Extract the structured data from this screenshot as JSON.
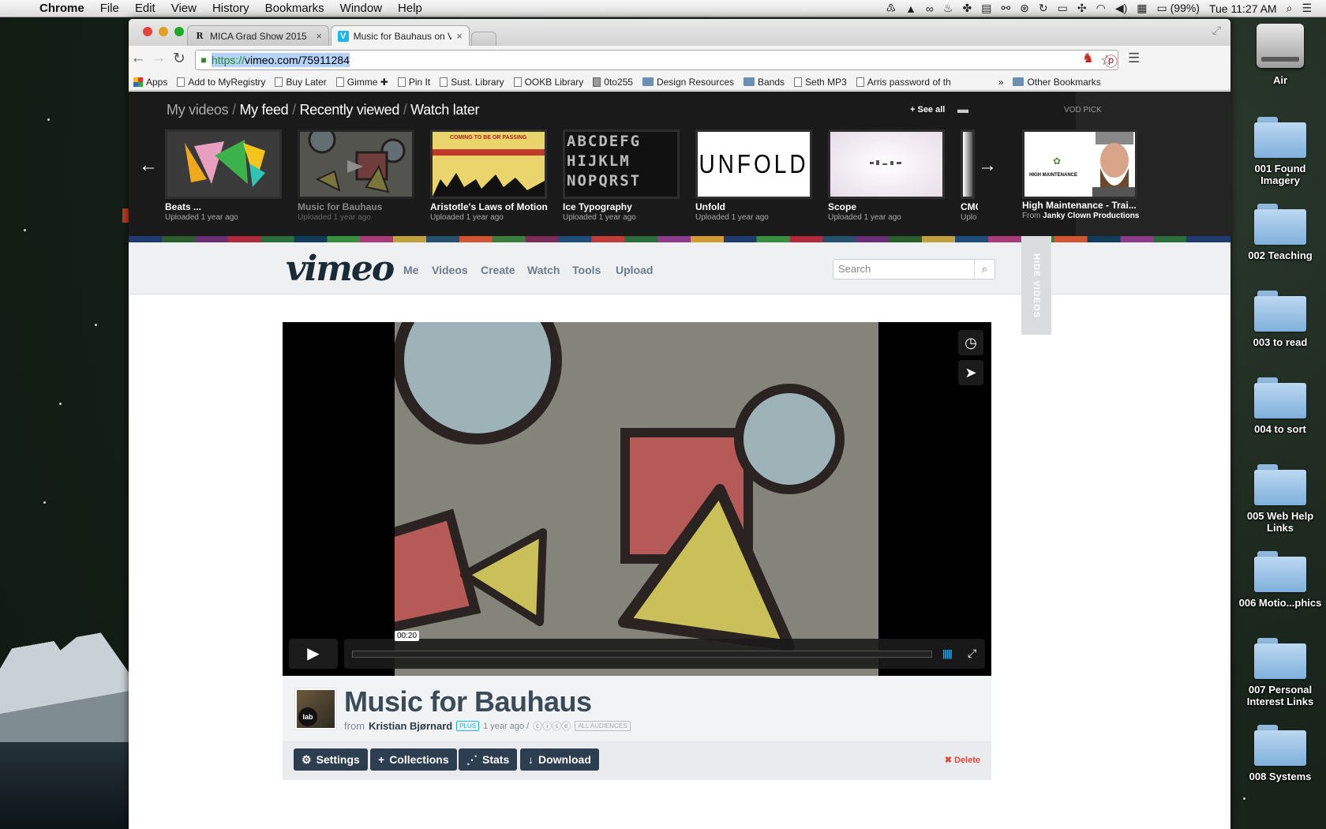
{
  "menubar": {
    "app": "Chrome",
    "items": [
      "File",
      "Edit",
      "View",
      "History",
      "Bookmarks",
      "Window",
      "Help"
    ],
    "battery": "(99%)",
    "clock": "Tue 11:27 AM"
  },
  "desktop": {
    "drive": "Air",
    "folders": [
      "001 Found Imagery",
      "002 Teaching",
      "003 to read",
      "004 to sort",
      "005 Web Help Links",
      "006 Motio...phics",
      "007 Personal Interest Links",
      "008 Systems"
    ]
  },
  "browser": {
    "tabs": [
      {
        "title": "MICA Grad Show 2015",
        "favicon": "R"
      },
      {
        "title": "Music for Bauhaus on Vime",
        "favicon": "V"
      }
    ],
    "url_scheme": "https://",
    "url_rest": "vimeo.com/75911284",
    "bookmarks": [
      "Apps",
      "Add to MyRegistry",
      "Buy Later",
      "Gimme ✚",
      "Pin It",
      "Sust. Library",
      "OOKB Library",
      "0to255",
      "Design Resources",
      "Bands",
      "Seth MP3",
      "Arris password of th"
    ],
    "overflow": "»",
    "other_bookmarks": "Other Bookmarks"
  },
  "feed": {
    "nav": {
      "my_videos": "My videos",
      "my_feed": "My feed",
      "recently_viewed": "Recently viewed",
      "watch_later": "Watch later",
      "sep": "/"
    },
    "see_all": "+ See all",
    "vod_pick_label": "VOD PICK",
    "videos": [
      {
        "title": "Beats ...",
        "sub": "Uploaded 1 year ago"
      },
      {
        "title": "Music for Bauhaus",
        "sub": "Uploaded 1 year ago"
      },
      {
        "title": "Aristotle's Laws of Motion",
        "sub": "Uploaded 1 year ago"
      },
      {
        "title": "Ice Typography",
        "sub": "Uploaded 1 year ago"
      },
      {
        "title": "Unfold",
        "sub": "Uploaded 1 year ago"
      },
      {
        "title": "Scope",
        "sub": "Uploaded 1 year ago"
      },
      {
        "title": "CMC",
        "sub": "Uplo"
      }
    ],
    "vod": {
      "title": "High Maintenance - Trai...",
      "from_label": "From",
      "from": "Janky Clown Productions"
    },
    "thumb_text": {
      "aristotle": "COMING TO BE OR PASSING",
      "ice": "ABCDEFG HIJKLM NOPQRST",
      "unfold": "UNFOLD",
      "vod": "HIGH MAINTENANCE"
    }
  },
  "vimeo": {
    "logo": "vimeo",
    "nav": [
      "Me",
      "Videos",
      "Create",
      "Watch",
      "Tools",
      "Upload"
    ],
    "search_placeholder": "Search",
    "hide_videos": "HIDE VIDEOS"
  },
  "player": {
    "timecode": "00:20",
    "progress": 0.0
  },
  "video": {
    "title": "Music for Bauhaus",
    "from_label": "from",
    "author": "Kristian Bjørnard",
    "plus": "PLUS",
    "age": "1 year ago /",
    "cc": "ⓒⓘⓢⓔ",
    "audience": "ALL AUDIENCES",
    "avatar_badge": "lab"
  },
  "actions": {
    "settings": "Settings",
    "collections": "Collections",
    "stats": "Stats",
    "download": "Download",
    "delete": "Delete"
  }
}
